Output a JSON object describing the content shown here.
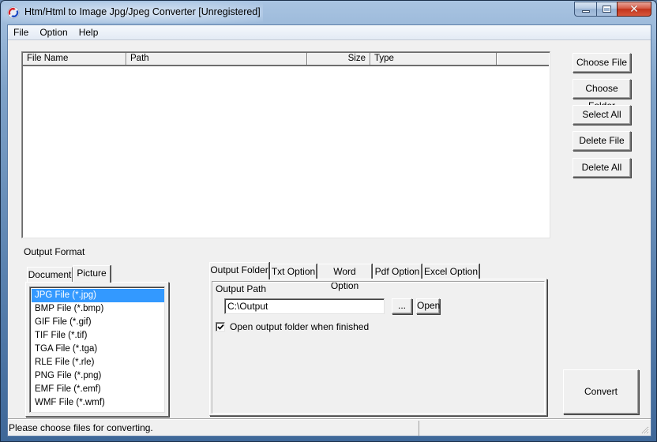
{
  "window": {
    "title": "Htm/Html to Image Jpg/Jpeg Converter [Unregistered]",
    "icon": "app-logo-icon",
    "controls": [
      "minimize",
      "maximize",
      "close"
    ]
  },
  "menu": {
    "items": [
      {
        "label": "File"
      },
      {
        "label": "Option"
      },
      {
        "label": "Help"
      }
    ]
  },
  "file_list": {
    "columns": [
      "File Name",
      "Path",
      "Size",
      "Type"
    ],
    "rows": []
  },
  "side_buttons": {
    "choose_file": "Choose File",
    "choose_folder": "Choose Folder",
    "select_all": "Select All",
    "delete_file": "Delete File",
    "delete_all": "Delete All"
  },
  "output_format": {
    "label": "Output Format",
    "tabs": [
      {
        "label": "Document",
        "active": false
      },
      {
        "label": "Picture",
        "active": true
      }
    ],
    "formats": [
      {
        "label": "JPG File  (*.jpg)",
        "selected": true
      },
      {
        "label": "BMP File  (*.bmp)",
        "selected": false
      },
      {
        "label": "GIF File  (*.gif)",
        "selected": false
      },
      {
        "label": "TIF File  (*.tif)",
        "selected": false
      },
      {
        "label": "TGA File  (*.tga)",
        "selected": false
      },
      {
        "label": "RLE File  (*.rle)",
        "selected": false
      },
      {
        "label": "PNG File  (*.png)",
        "selected": false
      },
      {
        "label": "EMF File  (*.emf)",
        "selected": false
      },
      {
        "label": "WMF File  (*.wmf)",
        "selected": false
      }
    ]
  },
  "options": {
    "tabs": [
      {
        "label": "Output Folder",
        "active": true
      },
      {
        "label": "Txt Option",
        "active": false
      },
      {
        "label": "Word Option",
        "active": false
      },
      {
        "label": "Pdf Option",
        "active": false
      },
      {
        "label": "Excel Option",
        "active": false
      }
    ],
    "output_path_label": "Output Path",
    "output_path_value": "C:\\Output",
    "browse_label": "...",
    "open_label": "Open",
    "open_when_finished_label": "Open output folder when finished",
    "open_when_finished_checked": true
  },
  "convert_label": "Convert",
  "status": {
    "message": "Please choose files for converting.",
    "secondary": ""
  },
  "colors": {
    "selection": "#3399ff",
    "close_button": "#c2341c",
    "face": "#f0f0f0"
  }
}
